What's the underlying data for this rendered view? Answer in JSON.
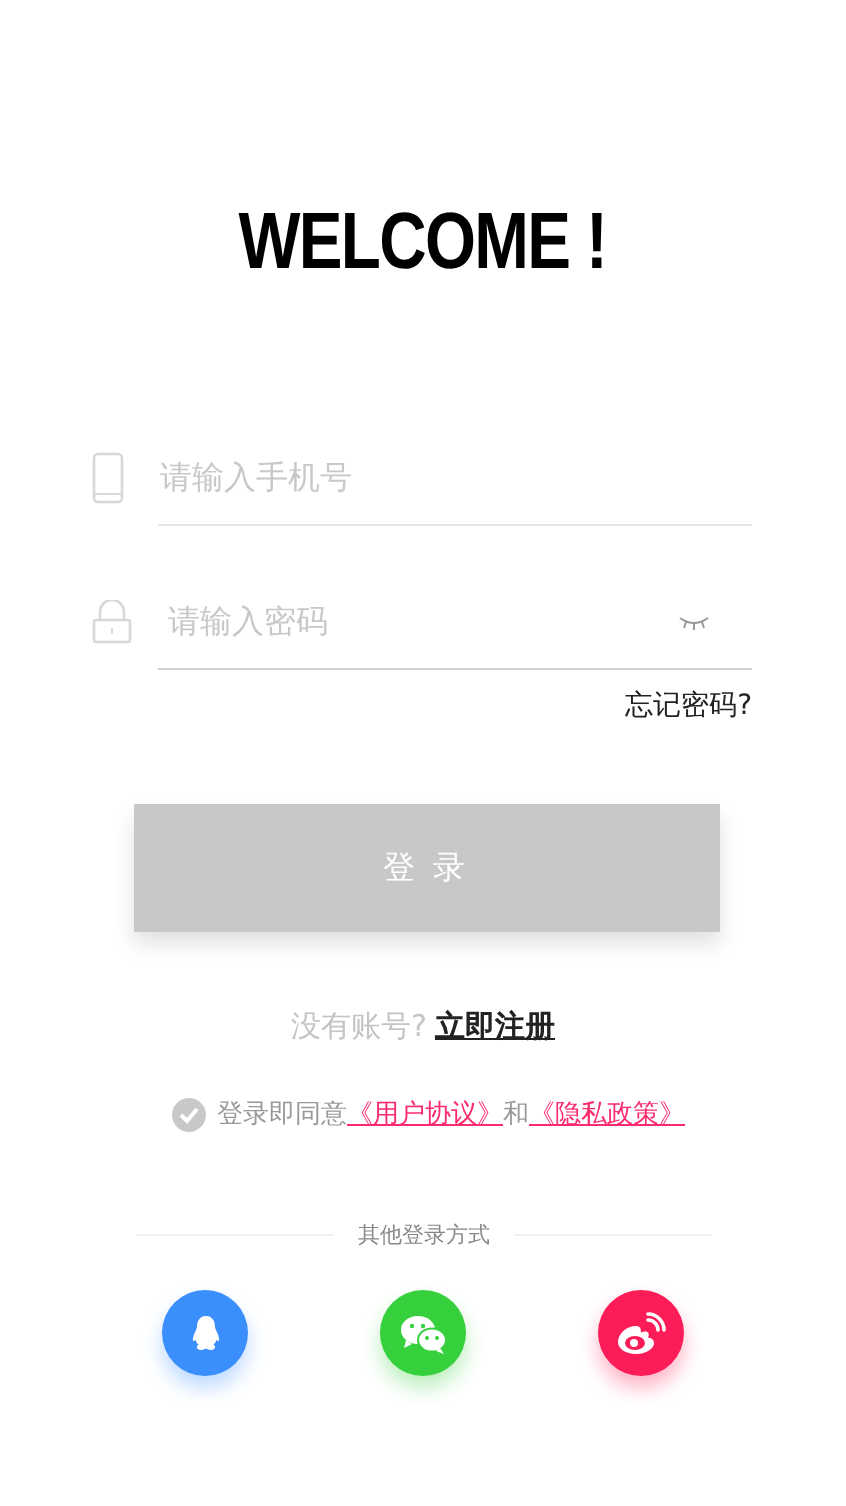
{
  "title": "WELCOME !",
  "fields": [
    {
      "kind": "phone",
      "placeholder": "请输入手机号"
    },
    {
      "kind": "password",
      "placeholder": "请输入密码",
      "password_visible": false
    }
  ],
  "forgot_link": "忘记密码?",
  "login_button": {
    "label": "登 录",
    "disabled": true
  },
  "register": {
    "prompt": "没有账号?",
    "link": "立即注册"
  },
  "agreement": {
    "agreed": false,
    "text": "登录即同意",
    "terms_link": "《用户协议》",
    "conjunction": "和",
    "privacy_link": "《隐私政策》"
  },
  "other_login": {
    "label": "其他登录方式",
    "buttons": [
      {
        "kind": "qq",
        "color": "#3b8ffc"
      },
      {
        "kind": "wechat",
        "color": "#36d03c"
      },
      {
        "kind": "weibo",
        "color": "#fc1c58"
      }
    ]
  }
}
